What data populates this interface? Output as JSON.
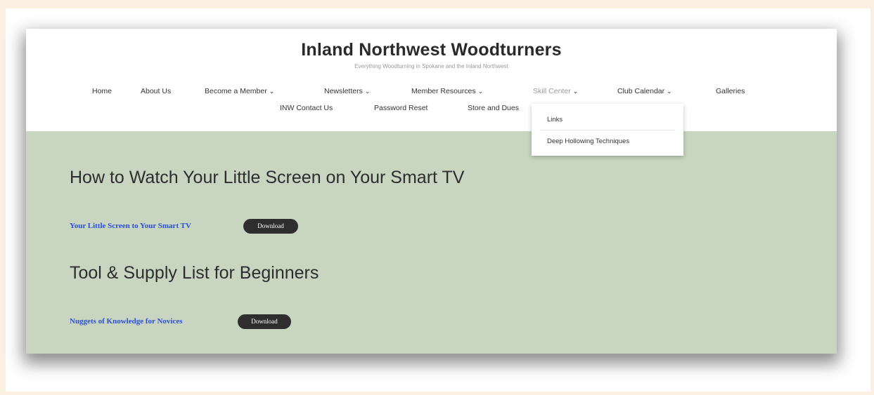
{
  "site": {
    "title": "Inland Northwest Woodturners",
    "tagline": "Everything Woodturning in Spokane and the Inland Northwest"
  },
  "nav": {
    "row1": [
      {
        "label": "Home",
        "has_dropdown": false
      },
      {
        "label": "About Us",
        "has_dropdown": false
      },
      {
        "label": "Become a Member",
        "has_dropdown": true
      },
      {
        "label": "Newsletters",
        "has_dropdown": true
      },
      {
        "label": "Member Resources",
        "has_dropdown": true
      },
      {
        "label": "Skill Center",
        "has_dropdown": true
      },
      {
        "label": "Club Calendar",
        "has_dropdown": true
      },
      {
        "label": "Galleries",
        "has_dropdown": false
      }
    ],
    "row2": [
      {
        "label": "INW Contact Us"
      },
      {
        "label": "Password Reset"
      },
      {
        "label": "Store and Dues"
      }
    ],
    "chevron": "⌄"
  },
  "dropdown": {
    "items": [
      "Links",
      "Deep Hollowing Techniques"
    ]
  },
  "content": {
    "sections": [
      {
        "heading": "How to Watch Your Little Screen on Your Smart TV",
        "link_text": "Your Little Screen to Your Smart TV",
        "button_label": "Download"
      },
      {
        "heading": "Tool & Supply List for Beginners",
        "link_text": "Nuggets of Knowledge for Novices",
        "button_label": "Download"
      }
    ]
  },
  "colors": {
    "page_background": "#fbefe2",
    "content_background": "#c8d6c1",
    "link": "#2d4fd6",
    "button": "#2e2e2e"
  }
}
